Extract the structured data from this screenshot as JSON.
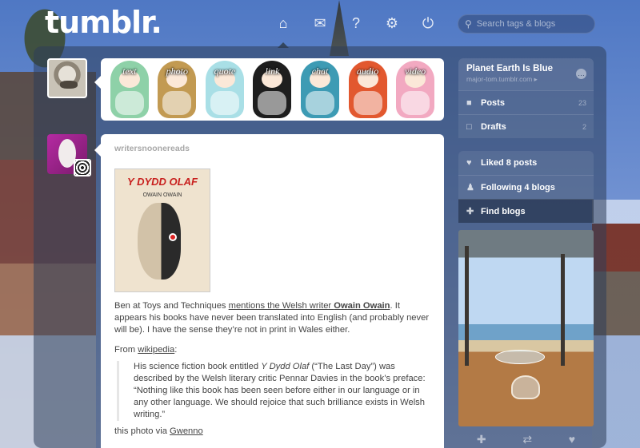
{
  "header": {
    "logo": "tumblr.",
    "nav": [
      {
        "name": "home-icon",
        "glyph": "⌂"
      },
      {
        "name": "mail-icon",
        "glyph": "✉"
      },
      {
        "name": "help-icon",
        "glyph": "?"
      },
      {
        "name": "gear-icon",
        "glyph": "⚙"
      },
      {
        "name": "power-icon",
        "glyph": "⏻"
      }
    ],
    "search_placeholder": "Search tags & blogs"
  },
  "post_types": [
    "text",
    "photo",
    "quote",
    "link",
    "chat",
    "audio",
    "video"
  ],
  "post": {
    "author": "writersnoonereads",
    "book_title": "Y DYDD OLAF",
    "book_author": "OWAIN OWAIN",
    "para1_a": "Ben at Toys and Techniques ",
    "para1_link": "mentions the Welsh writer ",
    "para1_bold_link": "Owain Owain",
    "para1_b": ". It appears his books have never been translated into English (and probably never will be). I have the sense they’re not in print in Wales either.",
    "from_label": "From ",
    "from_link": "wikipedia",
    "from_colon": ":",
    "quote_a": "His science fiction book entitled ",
    "quote_title": "Y Dydd Olaf",
    "quote_b": " (“The Last Day”) was described by the Welsh literary critic Pennar Davies in the book’s preface: “Nothing like this book has been seen before either in our language or in any other language. We should rejoice that such brilliance exists in Welsh writing.”",
    "photo_via": "this photo via ",
    "photo_via_link": "Gwenno"
  },
  "sidebar": {
    "blog_title": "Planet Earth Is Blue",
    "blog_subtitle": "major-tom.tumblr.com ▸",
    "posts_label": "Posts",
    "posts_count": "23",
    "drafts_label": "Drafts",
    "drafts_count": "2",
    "liked_label": "Liked 8 posts",
    "following_label": "Following 4 blogs",
    "find_label": "Find blogs"
  }
}
